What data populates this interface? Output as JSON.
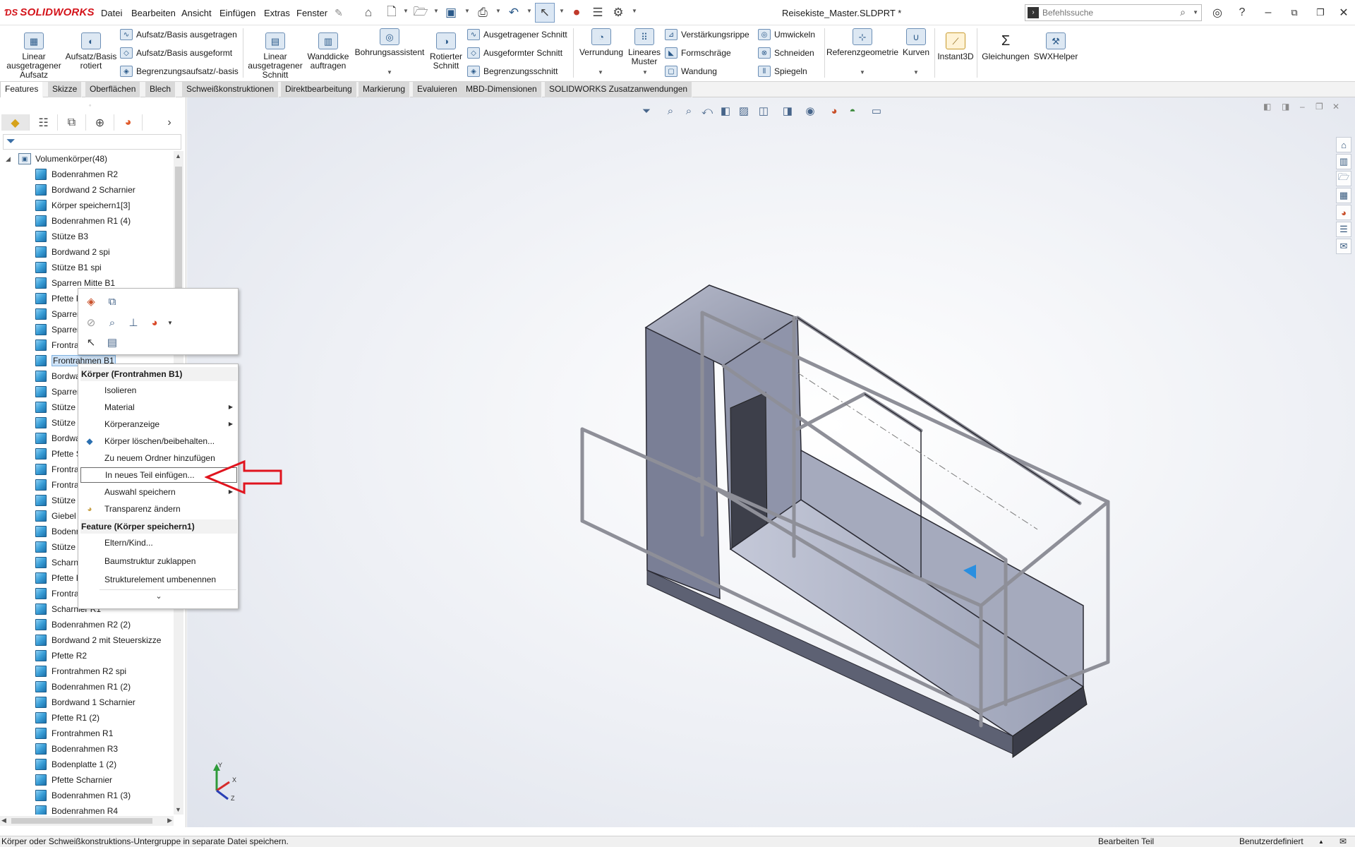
{
  "app": {
    "logo": "SOLIDWORKS",
    "document_title": "Reisekiste_Master.SLDPRT *",
    "search": {
      "placeholder": "Befehlssuche",
      "value": ""
    }
  },
  "menu": [
    "Datei",
    "Bearbeiten",
    "Ansicht",
    "Einfügen",
    "Extras",
    "Fenster"
  ],
  "ribbon": {
    "large_buttons": [
      {
        "label": "Linear ausgetragener Aufsatz",
        "icon": "extrude-boss-icon"
      },
      {
        "label": "Aufsatz/Basis rotiert",
        "icon": "revolve-boss-icon"
      },
      {
        "label": "Linear ausgetragener Schnitt",
        "icon": "extrude-cut-icon"
      },
      {
        "label": "Wanddicke auftragen",
        "icon": "thicken-icon"
      },
      {
        "label": "Bohrungsassistent",
        "icon": "hole-wizard-icon"
      },
      {
        "label": "Rotierter Schnitt",
        "icon": "revolve-cut-icon"
      },
      {
        "label": "Verrundung",
        "icon": "fillet-icon"
      },
      {
        "label": "Lineares Muster",
        "icon": "linear-pattern-icon"
      },
      {
        "label": "Referenzgeometrie",
        "icon": "reference-geometry-icon"
      },
      {
        "label": "Kurven",
        "icon": "curves-icon"
      },
      {
        "label": "Instant3D",
        "icon": "instant3d-icon"
      },
      {
        "label": "Gleichungen",
        "icon": "equations-icon"
      },
      {
        "label": "SWXHelper",
        "icon": "swxhelper-icon"
      }
    ],
    "small_buttons": [
      {
        "label": "Aufsatz/Basis ausgetragen",
        "icon": "swept-boss-icon"
      },
      {
        "label": "Aufsatz/Basis ausgeformt",
        "icon": "lofted-boss-icon"
      },
      {
        "label": "Begrenzungsaufsatz/-basis",
        "icon": "boundary-boss-icon"
      },
      {
        "label": "Ausgetragener Schnitt",
        "icon": "swept-cut-icon"
      },
      {
        "label": "Ausgeformter Schnitt",
        "icon": "lofted-cut-icon"
      },
      {
        "label": "Begrenzungsschnitt",
        "icon": "boundary-cut-icon"
      },
      {
        "label": "Verstärkungsrippe",
        "icon": "rib-icon"
      },
      {
        "label": "Formschräge",
        "icon": "draft-icon"
      },
      {
        "label": "Wandung",
        "icon": "shell-icon"
      },
      {
        "label": "Umwickeln",
        "icon": "wrap-icon"
      },
      {
        "label": "Schneiden",
        "icon": "intersect-icon"
      },
      {
        "label": "Spiegeln",
        "icon": "mirror-icon"
      }
    ]
  },
  "tabs": [
    "Features",
    "Skizze",
    "Oberflächen",
    "Blech",
    "Schweißkonstruktionen",
    "Direktbearbeitung",
    "Markierung",
    "Evaluieren",
    "MBD-Dimensionen",
    "SOLIDWORKS Zusatzanwendungen"
  ],
  "tree": {
    "root": "Volumenkörper(48)",
    "items": [
      "Bodenrahmen R2",
      "Bordwand 2 Scharnier",
      "Körper speichern1[3]",
      "Bodenrahmen R1 (4)",
      "Stütze B3",
      "Bordwand 2 spi",
      "Stütze B1 spi",
      "Sparren Mitte B1",
      "Pfette F",
      "Sparren",
      "Sparren",
      "Frontra",
      "Frontrahmen B1",
      "Bordwa",
      "Sparren",
      "Stütze",
      "Stütze",
      "Bordwa",
      "Pfette S",
      "Frontra",
      "Frontra",
      "Stütze",
      "Giebel",
      "Bodenr",
      "Stütze",
      "Scharn",
      "Pfette F",
      "Frontra",
      "Scharnier R1",
      "Bodenrahmen R2 (2)",
      "Bordwand 2 mit Steuerskizze",
      "Pfette R2",
      "Frontrahmen R2 spi",
      "Bodenrahmen R1 (2)",
      "Bordwand 1 Scharnier",
      "Pfette R1 (2)",
      "Frontrahmen R1",
      "Bodenrahmen R3",
      "Bodenplatte 1 (2)",
      "Pfette Scharnier",
      "Bodenrahmen R1 (3)",
      "Bodenrahmen R4"
    ],
    "selected_index": 12
  },
  "context_menu": {
    "header_body": "Körper (Frontrahmen B1)",
    "items_body": [
      {
        "label": "Isolieren",
        "submenu": false
      },
      {
        "label": "Material",
        "submenu": true
      },
      {
        "label": "Körperanzeige",
        "submenu": true
      },
      {
        "label": "Körper löschen/beibehalten...",
        "submenu": false
      },
      {
        "label": "Zu neuem Ordner hinzufügen",
        "submenu": false
      },
      {
        "label": "In neues Teil einfügen...",
        "submenu": false
      },
      {
        "label": "Auswahl speichern",
        "submenu": true
      },
      {
        "label": "Transparenz ändern",
        "submenu": false
      }
    ],
    "header_feature": "Feature (Körper speichern1)",
    "items_feature": [
      {
        "label": "Eltern/Kind...",
        "submenu": false
      },
      {
        "label": "Baumstruktur zuklappen",
        "submenu": false
      },
      {
        "label": "Strukturelement umbenennen",
        "submenu": false
      }
    ],
    "more_glyph": "⌄",
    "highlighted_item": "In neues Teil einfügen..."
  },
  "annotation": {
    "arrow_color": "#e0141e"
  },
  "triad": {
    "x": "X",
    "y": "Y",
    "z": "Z"
  },
  "statusbar": {
    "message": "Körper oder Schweißkonstruktions-Untergruppe in separate Datei speichern.",
    "mode": "Benutzerdefiniert",
    "state": "Bearbeiten Teil"
  },
  "colors": {
    "accent": "#d4141b",
    "selection": "#cfe3f7",
    "body_icon": "#3a9fd8"
  }
}
